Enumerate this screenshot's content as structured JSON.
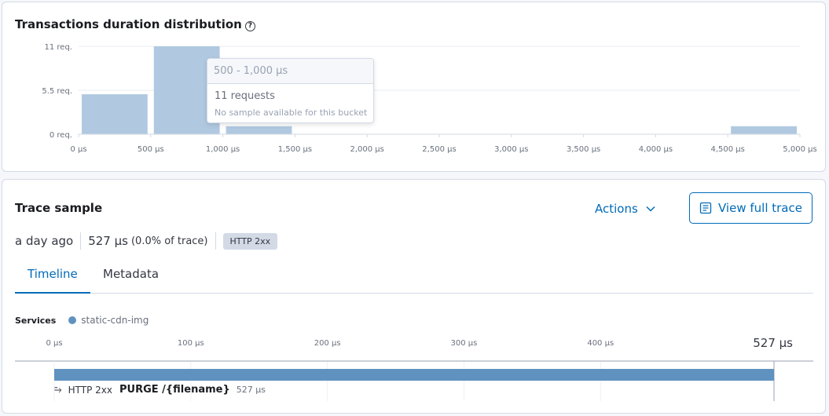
{
  "distribution": {
    "title": "Transactions duration distribution",
    "help_icon": "question-circle-icon",
    "tooltip": {
      "range": "500 - 1,000 μs",
      "count": "11 requests",
      "note": "No sample available for this bucket"
    }
  },
  "chart_data": {
    "type": "bar",
    "title": "Transactions duration distribution",
    "bucket_edges": [
      0,
      500,
      1000,
      1500,
      4500,
      5000
    ],
    "buckets": [
      {
        "x0": 0,
        "x1": 500,
        "value": 5
      },
      {
        "x0": 500,
        "x1": 1000,
        "value": 11
      },
      {
        "x0": 1000,
        "x1": 1500,
        "value": 1
      },
      {
        "x0": 4500,
        "x1": 5000,
        "value": 1
      }
    ],
    "xlim": [
      0,
      5000
    ],
    "ylim": [
      0,
      11
    ],
    "x_ticks": [
      0,
      500,
      1000,
      1500,
      2000,
      2500,
      3000,
      3500,
      4000,
      4500,
      5000
    ],
    "x_tick_labels": [
      "0 μs",
      "500 μs",
      "1,000 μs",
      "1,500 μs",
      "2,000 μs",
      "2,500 μs",
      "3,000 μs",
      "3,500 μs",
      "4,000 μs",
      "4,500 μs",
      "5,000 μs"
    ],
    "y_ticks": [
      0,
      5.5,
      11
    ],
    "y_tick_labels": [
      "0 req.",
      "5.5 req.",
      "11 req."
    ],
    "bar_color": "#b0c9e0",
    "grid": true
  },
  "trace": {
    "title": "Trace sample",
    "time_ago": "a day ago",
    "duration": "527 μs",
    "percent": "(0.0% of trace)",
    "status_badge": "HTTP 2xx",
    "actions_label": "Actions",
    "view_full_trace_label": "View full trace",
    "tabs": [
      {
        "label": "Timeline",
        "active": true
      },
      {
        "label": "Metadata",
        "active": false
      }
    ],
    "services_label": "Services",
    "service": {
      "name": "static-cdn-img",
      "color": "#6092c0"
    },
    "timeline": {
      "max_us": 527,
      "ticks": [
        0,
        100,
        200,
        300,
        400
      ],
      "tick_labels": [
        "0 μs",
        "100 μs",
        "200 μs",
        "300 μs",
        "400 μs"
      ],
      "end_label": "527 μs",
      "bar_color": "#6092c0"
    },
    "span": {
      "status": "HTTP 2xx",
      "name": "PURGE /{filename}",
      "duration": "527 μs",
      "icon": "merge-arrow-icon"
    }
  },
  "colors": {
    "accent": "#006bb8",
    "border": "#d3dae6",
    "text": "#343741"
  }
}
